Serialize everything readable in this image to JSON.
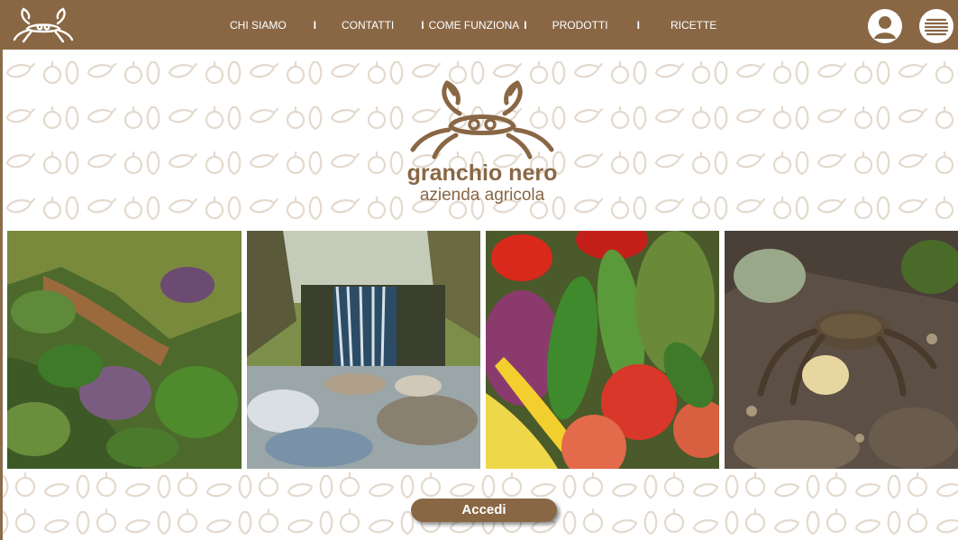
{
  "brand": {
    "name": "granchio nero",
    "subtitle": "azienda agricola",
    "color": "#896745"
  },
  "nav": {
    "items": [
      "CHI SIAMO",
      "CONTATTI",
      "COME FUNZIONA",
      "PRODOTTI",
      "RICETTE"
    ],
    "separator": "I"
  },
  "icons": {
    "logo": "crab-logo-icon",
    "user": "user-icon",
    "menu": "hamburger-menu-icon",
    "pattern": "vegetable-pattern"
  },
  "photos": [
    {
      "name": "vegetable-garden-photo"
    },
    {
      "name": "waterfall-photo"
    },
    {
      "name": "vegetables-photo"
    },
    {
      "name": "crab-photo"
    }
  ],
  "cta": {
    "label": "Accedi"
  }
}
